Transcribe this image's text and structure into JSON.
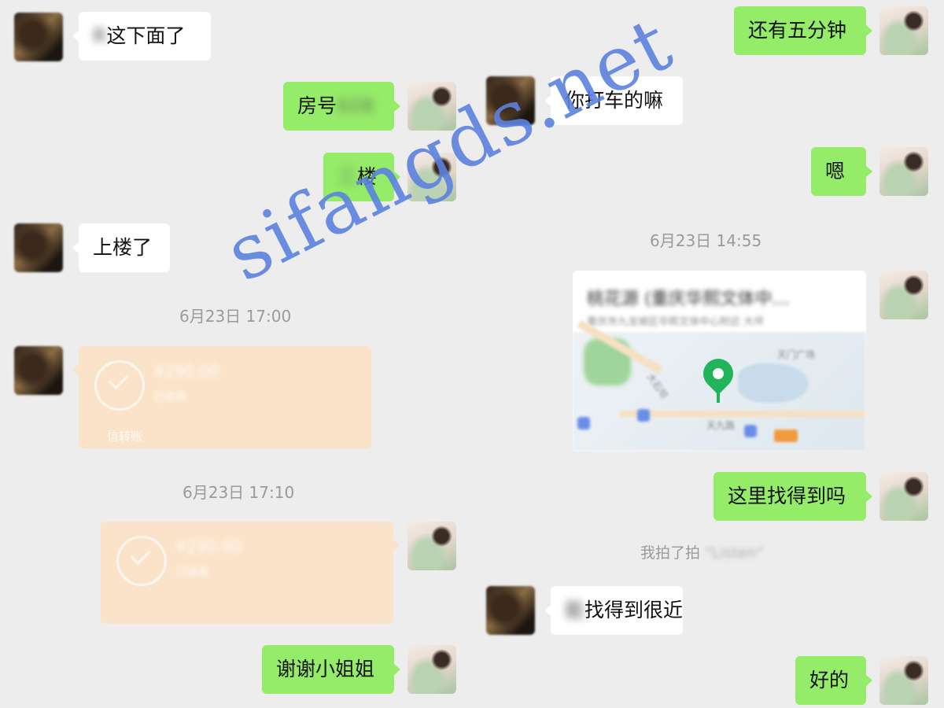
{
  "left_column": {
    "msg_1": {
      "visible_text": "这下面了",
      "obscured_prefix": "R"
    },
    "msg_2": {
      "label": "房号",
      "obscured": "608"
    },
    "msg_3": {
      "label": "楼",
      "obscured": "三"
    },
    "msg_4": {
      "text": "上楼了"
    },
    "time_1": "6月23日 17:00",
    "transfer_1": {
      "amount": "¥290.00",
      "sub": "已收款",
      "label": "信转账"
    },
    "time_2": "6月23日 17:10",
    "transfer_2": {
      "amount": "¥290.00",
      "sub": "已收款"
    },
    "msg_5": {
      "text": "谢谢小姐姐"
    }
  },
  "right_column": {
    "msg_1": {
      "text": "还有五分钟"
    },
    "msg_2": {
      "text": "你打车的嘛"
    },
    "msg_3": {
      "text": "嗯"
    },
    "time_1": "6月23日 14:55",
    "location": {
      "title": "桃花源 (重庆华熙文体中…",
      "address": "重庆市九龙坡区华熙文体中心附近 大坪",
      "map_labels": [
        "天门广场",
        "大石坝",
        "天九路"
      ]
    },
    "msg_4": {
      "text": "这里找得到吗"
    },
    "system": {
      "text": "我拍了拍",
      "obscured": "\"Listen\""
    },
    "msg_5": {
      "visible_text": "找得到很近",
      "obscured_prefix": "能"
    },
    "msg_6": {
      "text": "好的"
    }
  },
  "watermark": "sifangds.net",
  "colors": {
    "sent_bubble": "#95ec69",
    "received_bubble": "#ffffff",
    "transfer": "#fbe3c9",
    "background": "#ededed",
    "watermark": "#5b82e0"
  }
}
